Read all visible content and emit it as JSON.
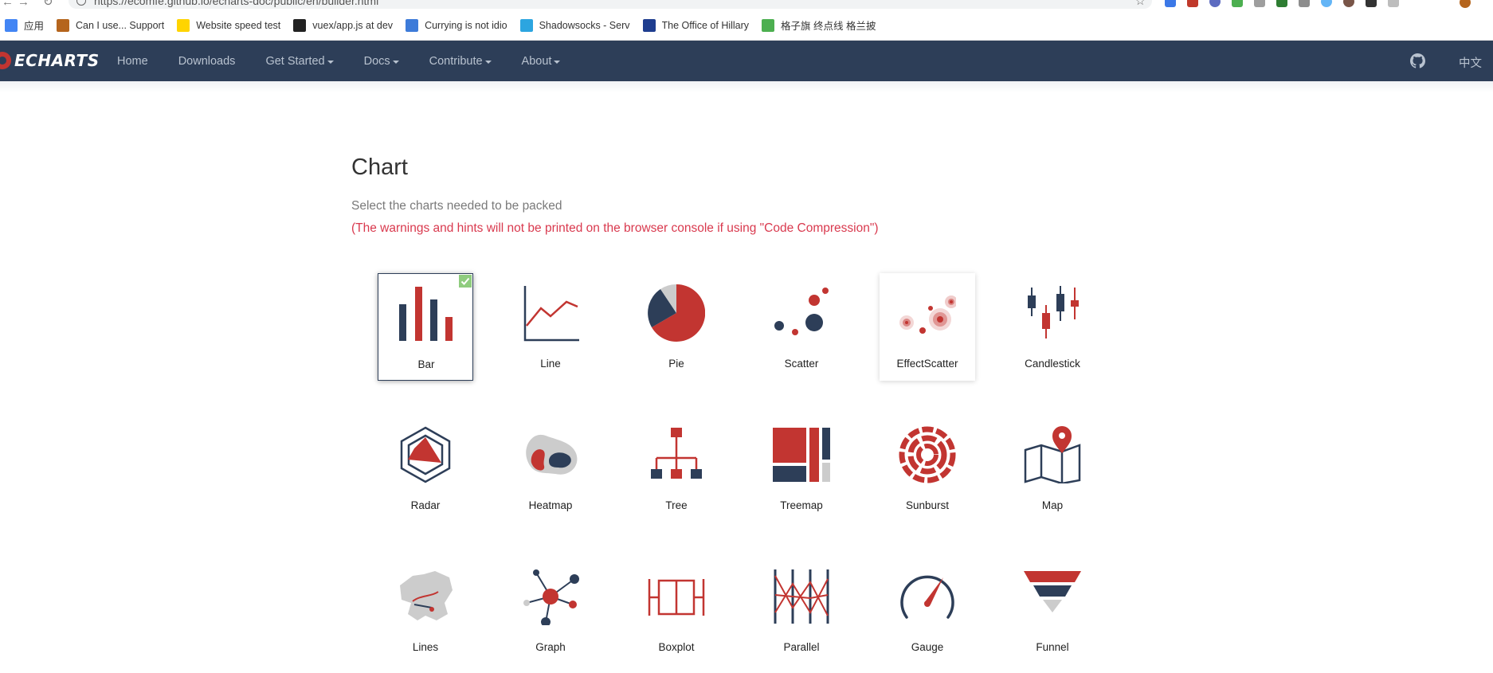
{
  "browser": {
    "url": "https://ecomfe.github.io/echarts-doc/public/en/builder.html",
    "bookmarks": [
      {
        "label": "应用",
        "icon": "apps-icon",
        "color": "#4285f4"
      },
      {
        "label": "Can I use... Support",
        "icon": "caniuse-icon",
        "color": "#b5651d"
      },
      {
        "label": "Website speed test",
        "icon": "pingdom-icon",
        "color": "#ffd400"
      },
      {
        "label": "vuex/app.js at dev",
        "icon": "github-icon",
        "color": "#222222"
      },
      {
        "label": "Currying is not idio",
        "icon": "blog-icon",
        "color": "#3d7bd9"
      },
      {
        "label": "Shadowsocks - Serv",
        "icon": "telegram-icon",
        "color": "#2ca5e0"
      },
      {
        "label": "The Office of Hillary",
        "icon": "office-icon",
        "color": "#1e3d8f"
      },
      {
        "label": "格子旗 终点线 格兰披",
        "icon": "px-icon",
        "color": "#4caf50"
      }
    ]
  },
  "nav": {
    "logo": "ECHARTS",
    "items": [
      {
        "label": "Home",
        "dropdown": false
      },
      {
        "label": "Downloads",
        "dropdown": false
      },
      {
        "label": "Get Started",
        "dropdown": true
      },
      {
        "label": "Docs",
        "dropdown": true
      },
      {
        "label": "Contribute",
        "dropdown": true
      },
      {
        "label": "About",
        "dropdown": true
      }
    ],
    "lang": "中文"
  },
  "section": {
    "title": "Chart",
    "subtitle": "Select the charts needed to be packed",
    "warning": "(The warnings and hints will not be printed on the browser console if using \"Code Compression\")"
  },
  "colors": {
    "dark": "#2d3e58",
    "red": "#c23531",
    "grey": "#cccccc",
    "accent": "#8fcc7e"
  },
  "charts": [
    {
      "label": "Bar",
      "icon": "bar-chart-icon",
      "selected": true
    },
    {
      "label": "Line",
      "icon": "line-chart-icon",
      "selected": false
    },
    {
      "label": "Pie",
      "icon": "pie-chart-icon",
      "selected": false
    },
    {
      "label": "Scatter",
      "icon": "scatter-chart-icon",
      "selected": false
    },
    {
      "label": "EffectScatter",
      "icon": "effect-scatter-chart-icon",
      "selected": false,
      "hovered": true
    },
    {
      "label": "Candlestick",
      "icon": "candlestick-chart-icon",
      "selected": false
    },
    {
      "label": "Radar",
      "icon": "radar-chart-icon",
      "selected": false
    },
    {
      "label": "Heatmap",
      "icon": "heatmap-chart-icon",
      "selected": false
    },
    {
      "label": "Tree",
      "icon": "tree-chart-icon",
      "selected": false
    },
    {
      "label": "Treemap",
      "icon": "treemap-chart-icon",
      "selected": false
    },
    {
      "label": "Sunburst",
      "icon": "sunburst-chart-icon",
      "selected": false
    },
    {
      "label": "Map",
      "icon": "map-chart-icon",
      "selected": false
    },
    {
      "label": "Lines",
      "icon": "lines-chart-icon",
      "selected": false
    },
    {
      "label": "Graph",
      "icon": "graph-chart-icon",
      "selected": false
    },
    {
      "label": "Boxplot",
      "icon": "boxplot-chart-icon",
      "selected": false
    },
    {
      "label": "Parallel",
      "icon": "parallel-chart-icon",
      "selected": false
    },
    {
      "label": "Gauge",
      "icon": "gauge-chart-icon",
      "selected": false
    },
    {
      "label": "Funnel",
      "icon": "funnel-chart-icon",
      "selected": false
    }
  ]
}
